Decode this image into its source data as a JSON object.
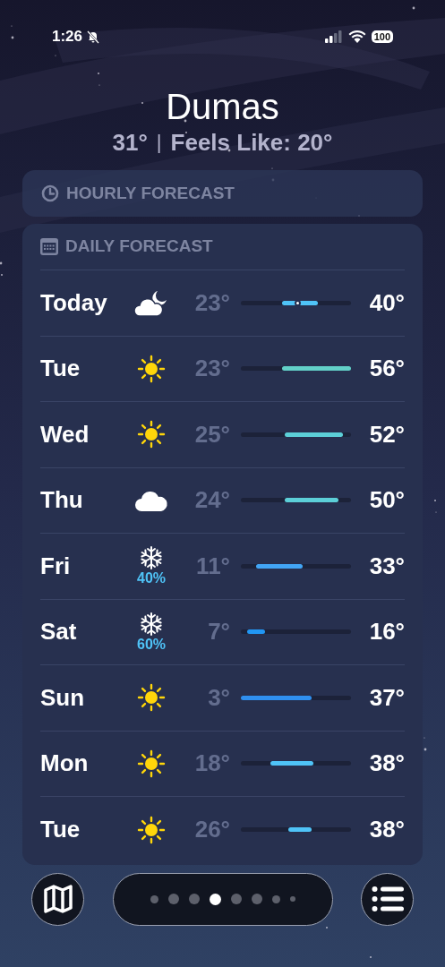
{
  "status_bar": {
    "time": "1:26",
    "silent": true,
    "battery": "100"
  },
  "location": {
    "city": "Dumas",
    "temperature": "31°",
    "separator": "|",
    "feels_like": "Feels Like: 20°"
  },
  "hourly": {
    "title": "HOURLY FORECAST"
  },
  "daily": {
    "title": "DAILY FORECAST",
    "days": [
      {
        "day": "Today",
        "kind": "moon-cloud",
        "low": "23°",
        "high": "40°",
        "bar": {
          "color": "#4fc3f7"
        }
      },
      {
        "day": "Tue",
        "kind": "sun",
        "low": "23°",
        "high": "56°",
        "bar": {
          "color": "#62d0c8"
        }
      },
      {
        "day": "Wed",
        "kind": "sun",
        "low": "25°",
        "high": "52°",
        "bar": {
          "color": "#5ccfd8"
        }
      },
      {
        "day": "Thu",
        "kind": "cloud",
        "low": "24°",
        "high": "50°",
        "bar": {
          "color": "#5ccfd8"
        }
      },
      {
        "day": "Fri",
        "kind": "snow",
        "precip": "40%",
        "low": "11°",
        "high": "33°",
        "bar": {
          "color": "#42a5f5"
        }
      },
      {
        "day": "Sat",
        "kind": "snow",
        "precip": "60%",
        "low": "7°",
        "high": "16°",
        "bar": {
          "color": "#2196f3"
        }
      },
      {
        "day": "Sun",
        "kind": "sun",
        "low": "3°",
        "high": "37°",
        "bar": {
          "color": "#2f8fef"
        }
      },
      {
        "day": "Mon",
        "kind": "sun",
        "low": "18°",
        "high": "38°",
        "bar": {
          "color": "#4fc3f7"
        }
      },
      {
        "day": "Tue",
        "kind": "sun",
        "low": "26°",
        "high": "38°",
        "bar": {
          "color": "#4fc3f7"
        }
      }
    ]
  },
  "page_dots": [
    {
      "selected": false
    },
    {
      "selected": false
    },
    {
      "selected": false
    },
    {
      "selected": true
    },
    {
      "selected": false
    },
    {
      "selected": false
    },
    {
      "selected": false
    },
    {
      "selected": false
    }
  ]
}
